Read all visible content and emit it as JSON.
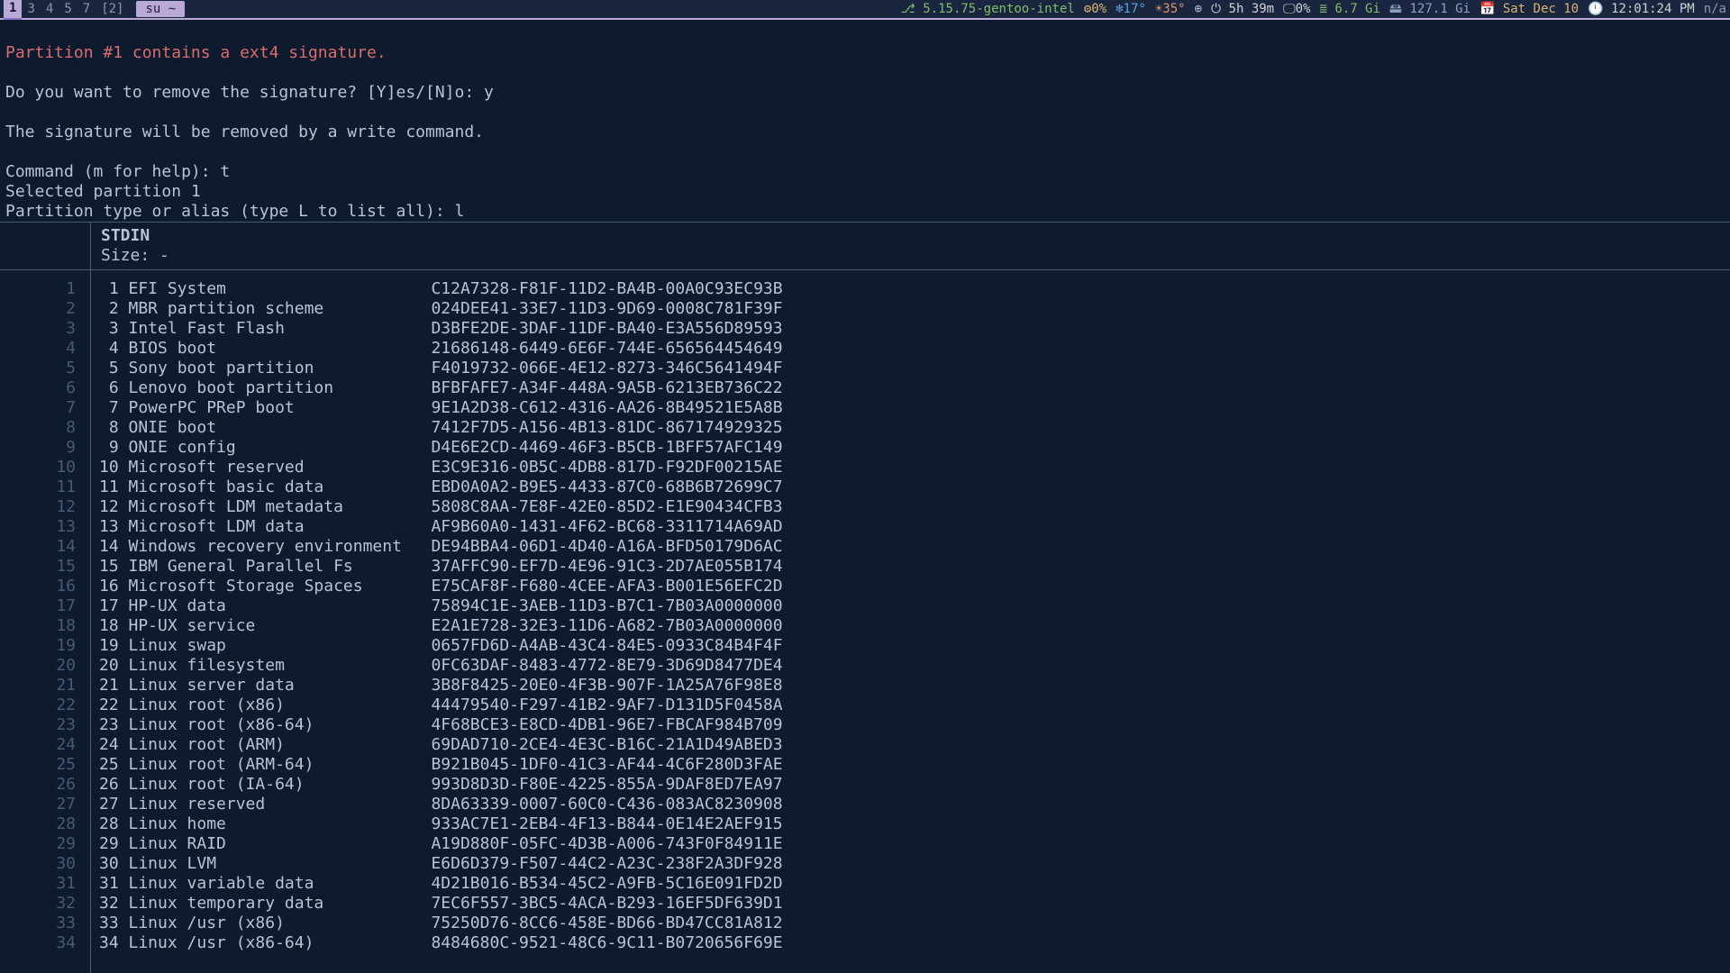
{
  "topbar": {
    "workspaces": [
      "1",
      "3",
      "4",
      "5",
      "7"
    ],
    "active_ws": "1",
    "alt_ws": "[2]",
    "title": "su ~",
    "kernel_icon": "⎇",
    "kernel": "5.15.75-gentoo-intel",
    "wind_icon": "⚙",
    "wind": "0%",
    "temp1_icon": "❄",
    "temp1": "17°",
    "temp2_icon": "☀",
    "temp2": "35°",
    "net_icon": "⊕",
    "uptime_icon": "⏻",
    "uptime": "5h 39m",
    "cpu_icon": "🖵",
    "cpu": "0%",
    "mem_icon": "≣",
    "mem": "6.7 Gi",
    "disk_icon": "🖴",
    "disk": "127.1 Gi",
    "date_icon": "📅",
    "date": "Sat Dec 10",
    "clock_icon": "🕛",
    "clock": "12:01:24 PM",
    "na": "n/a"
  },
  "pre_lines": {
    "l0": "Partition #1 contains a ext4 signature.",
    "l1": "",
    "l2": "Do you want to remove the signature? [Y]es/[N]o: y",
    "l3": "",
    "l4": "The signature will be removed by a write command.",
    "l5": "",
    "l6": "Command (m for help): t",
    "l7": "Selected partition 1",
    "l8": "Partition type or alias (type L to list all): l"
  },
  "pager_header": {
    "title": "STDIN",
    "size_label": "Size: ",
    "size_value": "-"
  },
  "partition_types": [
    {
      "n": "1",
      "name": "EFI System",
      "guid": "C12A7328-F81F-11D2-BA4B-00A0C93EC93B"
    },
    {
      "n": "2",
      "name": "MBR partition scheme",
      "guid": "024DEE41-33E7-11D3-9D69-0008C781F39F"
    },
    {
      "n": "3",
      "name": "Intel Fast Flash",
      "guid": "D3BFE2DE-3DAF-11DF-BA40-E3A556D89593"
    },
    {
      "n": "4",
      "name": "BIOS boot",
      "guid": "21686148-6449-6E6F-744E-656564454649"
    },
    {
      "n": "5",
      "name": "Sony boot partition",
      "guid": "F4019732-066E-4E12-8273-346C5641494F"
    },
    {
      "n": "6",
      "name": "Lenovo boot partition",
      "guid": "BFBFAFE7-A34F-448A-9A5B-6213EB736C22"
    },
    {
      "n": "7",
      "name": "PowerPC PReP boot",
      "guid": "9E1A2D38-C612-4316-AA26-8B49521E5A8B"
    },
    {
      "n": "8",
      "name": "ONIE boot",
      "guid": "7412F7D5-A156-4B13-81DC-867174929325"
    },
    {
      "n": "9",
      "name": "ONIE config",
      "guid": "D4E6E2CD-4469-46F3-B5CB-1BFF57AFC149"
    },
    {
      "n": "10",
      "name": "Microsoft reserved",
      "guid": "E3C9E316-0B5C-4DB8-817D-F92DF00215AE"
    },
    {
      "n": "11",
      "name": "Microsoft basic data",
      "guid": "EBD0A0A2-B9E5-4433-87C0-68B6B72699C7"
    },
    {
      "n": "12",
      "name": "Microsoft LDM metadata",
      "guid": "5808C8AA-7E8F-42E0-85D2-E1E90434CFB3"
    },
    {
      "n": "13",
      "name": "Microsoft LDM data",
      "guid": "AF9B60A0-1431-4F62-BC68-3311714A69AD"
    },
    {
      "n": "14",
      "name": "Windows recovery environment",
      "guid": "DE94BBA4-06D1-4D40-A16A-BFD50179D6AC"
    },
    {
      "n": "15",
      "name": "IBM General Parallel Fs",
      "guid": "37AFFC90-EF7D-4E96-91C3-2D7AE055B174"
    },
    {
      "n": "16",
      "name": "Microsoft Storage Spaces",
      "guid": "E75CAF8F-F680-4CEE-AFA3-B001E56EFC2D"
    },
    {
      "n": "17",
      "name": "HP-UX data",
      "guid": "75894C1E-3AEB-11D3-B7C1-7B03A0000000"
    },
    {
      "n": "18",
      "name": "HP-UX service",
      "guid": "E2A1E728-32E3-11D6-A682-7B03A0000000"
    },
    {
      "n": "19",
      "name": "Linux swap",
      "guid": "0657FD6D-A4AB-43C4-84E5-0933C84B4F4F"
    },
    {
      "n": "20",
      "name": "Linux filesystem",
      "guid": "0FC63DAF-8483-4772-8E79-3D69D8477DE4"
    },
    {
      "n": "21",
      "name": "Linux server data",
      "guid": "3B8F8425-20E0-4F3B-907F-1A25A76F98E8"
    },
    {
      "n": "22",
      "name": "Linux root (x86)",
      "guid": "44479540-F297-41B2-9AF7-D131D5F0458A"
    },
    {
      "n": "23",
      "name": "Linux root (x86-64)",
      "guid": "4F68BCE3-E8CD-4DB1-96E7-FBCAF984B709"
    },
    {
      "n": "24",
      "name": "Linux root (ARM)",
      "guid": "69DAD710-2CE4-4E3C-B16C-21A1D49ABED3"
    },
    {
      "n": "25",
      "name": "Linux root (ARM-64)",
      "guid": "B921B045-1DF0-41C3-AF44-4C6F280D3FAE"
    },
    {
      "n": "26",
      "name": "Linux root (IA-64)",
      "guid": "993D8D3D-F80E-4225-855A-9DAF8ED7EA97"
    },
    {
      "n": "27",
      "name": "Linux reserved",
      "guid": "8DA63339-0007-60C0-C436-083AC8230908"
    },
    {
      "n": "28",
      "name": "Linux home",
      "guid": "933AC7E1-2EB4-4F13-B844-0E14E2AEF915"
    },
    {
      "n": "29",
      "name": "Linux RAID",
      "guid": "A19D880F-05FC-4D3B-A006-743F0F84911E"
    },
    {
      "n": "30",
      "name": "Linux LVM",
      "guid": "E6D6D379-F507-44C2-A23C-238F2A3DF928"
    },
    {
      "n": "31",
      "name": "Linux variable data",
      "guid": "4D21B016-B534-45C2-A9FB-5C16E091FD2D"
    },
    {
      "n": "32",
      "name": "Linux temporary data",
      "guid": "7EC6F557-3BC5-4ACA-B293-16EF5DF639D1"
    },
    {
      "n": "33",
      "name": "Linux /usr (x86)",
      "guid": "75250D76-8CC6-458E-BD66-BD47CC81A812"
    },
    {
      "n": "34",
      "name": "Linux /usr (x86-64)",
      "guid": "8484680C-9521-48C6-9C11-B0720656F69E"
    }
  ]
}
